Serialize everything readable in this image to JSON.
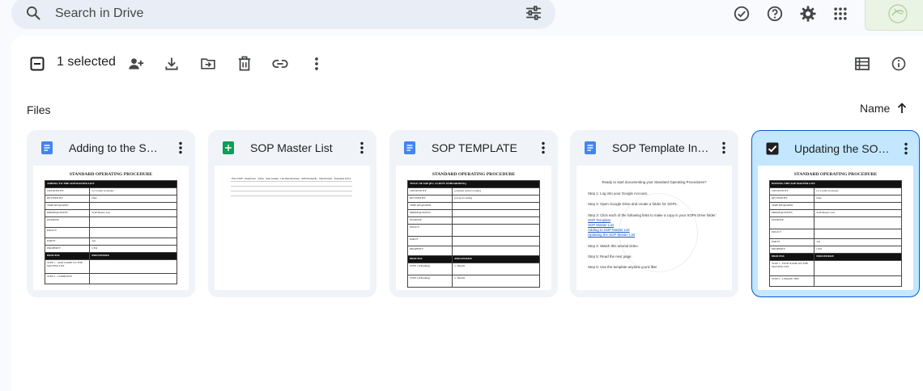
{
  "search": {
    "placeholder": "Search in Drive"
  },
  "header_icons": [
    "offline-check-icon",
    "help-icon",
    "settings-icon",
    "apps-grid-icon"
  ],
  "selection": {
    "count_text": "1 selected"
  },
  "selection_actions": [
    "deselect",
    "share",
    "download",
    "move",
    "delete",
    "copy-link",
    "more-actions"
  ],
  "section": {
    "files_label": "Files"
  },
  "sort": {
    "label": "Name",
    "direction": "ascending"
  },
  "colors": {
    "selected_card_bg": "#c2e7ff",
    "selected_border": "#0b57d0",
    "docs_blue": "#4285f4",
    "sheets_green": "#0f9d58"
  },
  "files": [
    {
      "name": "Adding to the SOP Master List",
      "type": "doc",
      "selected": false,
      "preview": {
        "title": "STANDARD OPERATING PROCEDURE",
        "rows": [
          [
            "ADDING TO THE SOP MASTER LIST",
            ""
          ],
          [
            "CREATED BY",
            "La Crema Gonzalez"
          ],
          [
            "REVISED BY",
            "Date"
          ],
          [
            "TIME REQUIRED",
            ""
          ],
          [
            "PREREQUISITES",
            "SOP Master List"
          ],
          [
            "PURPOSE",
            ""
          ],
          [
            "POLICY",
            ""
          ],
          [
            "PARTY",
            "All"
          ],
          [
            "PROPERTY",
            "CEO"
          ],
          [
            "PROCESS",
            "PROCEDURE"
          ],
          [
            "STEP 1 - ADD NAME TO THE MASTER LIST",
            ""
          ],
          [
            "STEP 2 - COMPLETE",
            ""
          ]
        ]
      }
    },
    {
      "name": "SOP Master List",
      "type": "sheet",
      "selected": false,
      "preview": {
        "rows": [
          [
            "Title of SOP",
            "Department",
            "Author",
            "Date Created",
            "Last Date Reviewed",
            "SOP Revised By",
            "Date Revised",
            "Associated Forms"
          ]
        ]
      }
    },
    {
      "name": "SOP TEMPLATE",
      "type": "doc",
      "selected": false,
      "preview": {
        "title": "STANDARD OPERATING PROCEDURE",
        "rows": [
          [
            "TITLE OF SOP [Ex: CLIENT ONBOARDING]",
            ""
          ],
          [
            "CREATED BY",
            "[original author's name]"
          ],
          [
            "REVISED BY",
            "[revisor's name]"
          ],
          [
            "TIME REQUIRED",
            ""
          ],
          [
            "PREREQUISITES",
            ""
          ],
          [
            "PURPOSE",
            ""
          ],
          [
            "POLICY",
            ""
          ],
          [
            "PARTY",
            ""
          ],
          [
            "PROPERTY",
            ""
          ],
          [
            "PROCESS",
            "PROCEDURE"
          ],
          [
            "STEP 1 (Heading)",
            "a. Details"
          ],
          [
            "STEP 2 (Heading)",
            "a. Details"
          ]
        ]
      }
    },
    {
      "name": "SOP Template Instructions",
      "type": "doc",
      "selected": false,
      "preview": {
        "heading": "Ready to start documenting your Standard Operating Procedures?",
        "lines": [
          "Step 1: Log into your Google Account.",
          "Step 2: Open Google Drive and create a folder for SOPs.",
          "Step 3: Click each of the following links to make a copy in your SOPs Drive folder:",
          "SOP Template",
          "SOP Master List",
          "Adding to SOP Master List",
          "Updating the SOP Master List",
          "Step 4: Watch this tutorial video.",
          "Step 5: Read the next page.",
          "Step 6: Use the template anytime you'd like!"
        ]
      }
    },
    {
      "name": "Updating the SOP Master List",
      "type": "doc",
      "selected": true,
      "preview": {
        "title": "STANDARD OPERATING PROCEDURE",
        "rows": [
          [
            "EDITING THE SOP MASTER LIST",
            ""
          ],
          [
            "CREATED BY",
            "La Crema Gonzalez"
          ],
          [
            "REVISED BY",
            "Date"
          ],
          [
            "TIME REQUIRED",
            ""
          ],
          [
            "PREREQUISITES",
            "SOP Master List"
          ],
          [
            "PURPOSE",
            ""
          ],
          [
            "POLICY",
            ""
          ],
          [
            "PARTY",
            "All"
          ],
          [
            "PROPERTY",
            "CEO"
          ],
          [
            "PROCESS",
            "PROCEDURE"
          ],
          [
            "STEP 1 - FIND NAME ON THE MASTER LIST",
            ""
          ],
          [
            "STEP 2 - UPDATE THE",
            ""
          ]
        ]
      }
    }
  ]
}
